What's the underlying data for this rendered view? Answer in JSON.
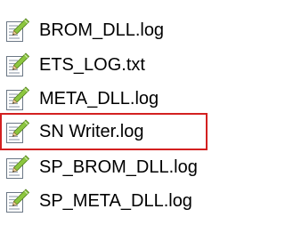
{
  "files": [
    {
      "name": "BROM_DLL.log",
      "icon": "notepad-document-icon"
    },
    {
      "name": "ETS_LOG.txt",
      "icon": "notepad-document-icon"
    },
    {
      "name": "META_DLL.log",
      "icon": "notepad-document-icon"
    },
    {
      "name": "SN Writer.log",
      "icon": "notepad-document-icon"
    },
    {
      "name": "SP_BROM_DLL.log",
      "icon": "notepad-document-icon"
    },
    {
      "name": "SP_META_DLL.log",
      "icon": "notepad-document-icon"
    }
  ],
  "highlighted_file": "SN Writer.log",
  "colors": {
    "highlight_border": "#d32020",
    "icon_pencil": "#8cc63f",
    "icon_page": "#ffffff",
    "icon_lines": "#9aa4b0"
  }
}
